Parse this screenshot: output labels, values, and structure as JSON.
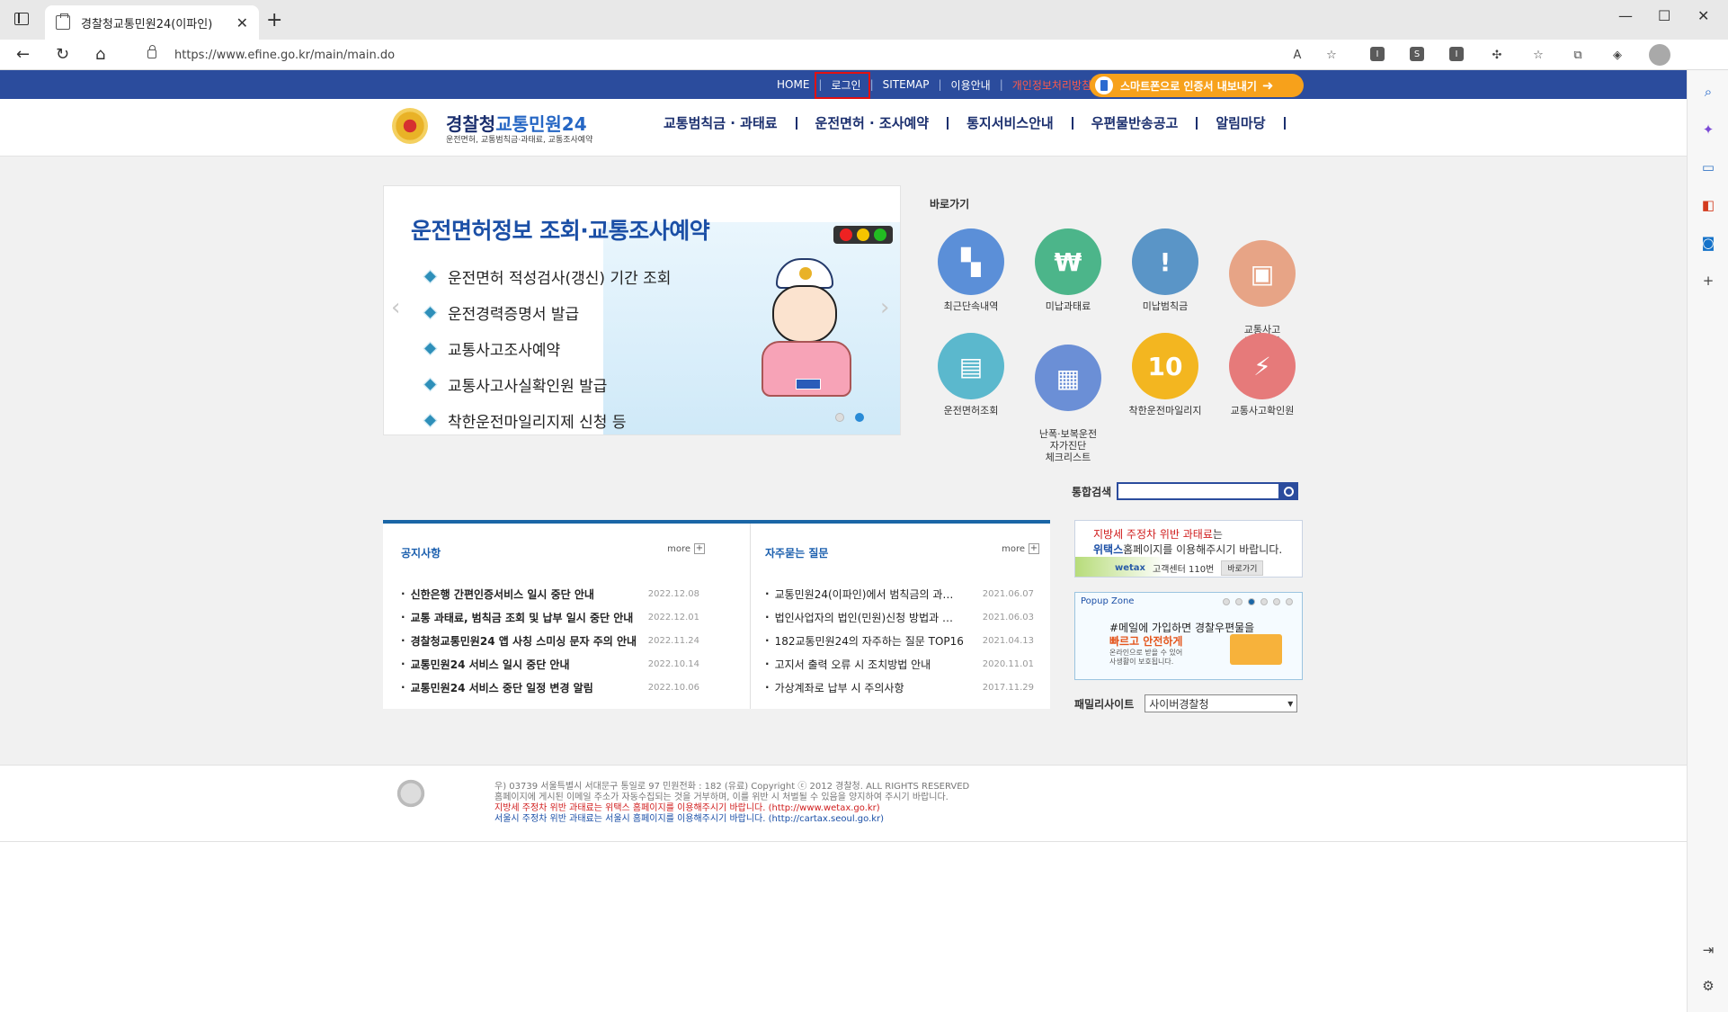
{
  "browser": {
    "tab_title": "경찰청교통민원24(이파인)",
    "url": "https://www.efine.go.kr/main/main.do",
    "toolbar_boxes": [
      "I",
      "S",
      "I"
    ]
  },
  "util_nav": {
    "home": "HOME",
    "login": "로그인",
    "sitemap": "SITEMAP",
    "guide": "이용안내",
    "red_link": "개인정보처리방침",
    "smart_btn": "스마트폰으로 인증서 내보내기"
  },
  "logo": {
    "title_a": "경찰청",
    "title_b": "교통민원24",
    "subtitle": "운전면허, 교통범칙금·과태료, 교통조사예약"
  },
  "gnb": [
    "교통범칙금 · 과태료",
    "운전면허 · 조사예약",
    "통지서비스안내",
    "우편물반송공고",
    "알림마당"
  ],
  "banner": {
    "title": "운전면허정보 조회·교통조사예약",
    "items": [
      "운전면허 적성검사(갱신) 기간 조회",
      "운전경력증명서 발급",
      "교통사고조사예약",
      "교통사고사실확인원 발급",
      "착한운전마일리지제 신청 등"
    ]
  },
  "quick": {
    "title": "바로가기",
    "items": [
      {
        "label": "최근단속내역",
        "color": "#5b8fd8",
        "icon": "camera-icon",
        "glyph": "▚"
      },
      {
        "label": "미납과태료",
        "color": "#4cb58a",
        "icon": "money-icon",
        "glyph": "₩"
      },
      {
        "label": "미납범칙금",
        "color": "#5a95c7",
        "icon": "warning-icon",
        "glyph": "!"
      },
      {
        "label": "교통사고\n조사예약",
        "color": "#e7a486",
        "icon": "monitor-icon",
        "glyph": "▣"
      },
      {
        "label": "운전면허조회",
        "color": "#5bb8cd",
        "icon": "id-card-icon",
        "glyph": "▤"
      },
      {
        "label": "난폭·보복운전\n자가진단\n체크리스트",
        "color": "#6b8fd6",
        "icon": "checklist-icon",
        "glyph": "▦"
      },
      {
        "label": "착한운전마일리지",
        "color": "#f3b620",
        "icon": "mileage-icon",
        "glyph": "10"
      },
      {
        "label": "교통사고확인원",
        "color": "#e67a7a",
        "icon": "accident-icon",
        "glyph": "⚡"
      }
    ]
  },
  "search": {
    "label": "통합검색"
  },
  "notice": {
    "title": "공지사항",
    "more": "more",
    "items": [
      {
        "text": "신한은행 간편인증서비스 일시 중단 안내",
        "date": "2022.12.08"
      },
      {
        "text": "교통 과태료, 범칙금 조회 및 납부 일시 중단 안내",
        "date": "2022.12.01"
      },
      {
        "text": "경찰청교통민원24 앱 사칭 스미싱 문자 주의 안내",
        "date": "2022.11.24"
      },
      {
        "text": "교통민원24 서비스 일시 중단 안내",
        "date": "2022.10.14"
      },
      {
        "text": "교통민원24 서비스 중단 일정 변경 알림",
        "date": "2022.10.06"
      }
    ]
  },
  "faq": {
    "title": "자주묻는 질문",
    "more": "more",
    "items": [
      {
        "text": "교통민원24(이파인)에서 범칙금의 과…",
        "date": "2021.06.07"
      },
      {
        "text": "법인사업자의 법인(민원)신청 방법과 …",
        "date": "2021.06.03"
      },
      {
        "text": "182교통민원24의 자주하는 질문 TOP16",
        "date": "2021.04.13"
      },
      {
        "text": "고지서 출력 오류 시 조치방법 안내",
        "date": "2020.11.01"
      },
      {
        "text": "가상계좌로 납부 시 주의사항",
        "date": "2017.11.29"
      }
    ]
  },
  "wetax": {
    "line1_red": "지방세 주정차 위반 과태료",
    "line1_rest": "는",
    "line2_bold": "위택스",
    "line2_rest": "홈페이지를 이용해주시기 바랍니다.",
    "brand": "wetax",
    "center": "고객센터 110번",
    "go": "바로가기"
  },
  "popup": {
    "title": "Popup Zone",
    "line1": "#메일에 가입하면 경찰우편물을",
    "line2": "빠르고 안전하게",
    "line3": "온라인으로 받을 수 있어",
    "line4": "사생활이 보호됩니다."
  },
  "family": {
    "label": "패밀리사이트",
    "selected": "사이버경찰청"
  },
  "footer": {
    "line1": "우) 03739 서울특별시 서대문구 통일로 97  민원전화 : 182 (유료)      Copyright ⓒ 2012 경찰청. ALL RIGHTS RESERVED",
    "line2": "홈페이지에 게시된 이메일 주소가 자동수집되는 것을 거부하며, 이를 위반 시 처벌될 수 있음을 양지하여 주시기 바랍니다.",
    "line3": "지방세 주정차 위반 과태료는 위택스 홈페이지를 이용해주시기 바랍니다. (http://www.wetax.go.kr)",
    "line4": "서울시 주정차 위반 과태료는 서울시 홈페이지를 이용해주시기 바랍니다. (http://cartax.seoul.go.kr)"
  }
}
